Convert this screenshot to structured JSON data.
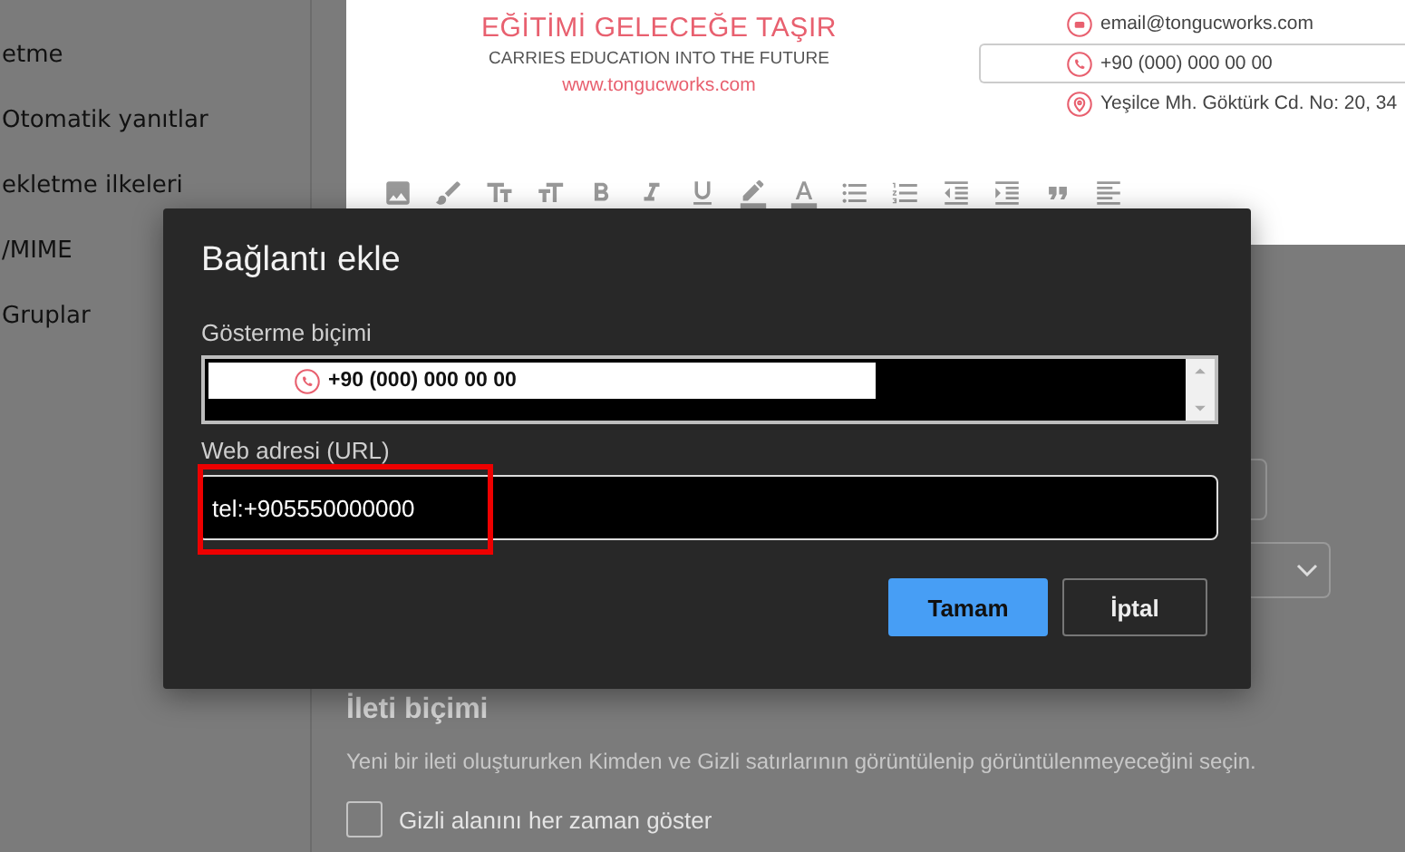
{
  "sidebar": {
    "items": [
      "etme",
      "Otomatik yanıtlar",
      "ekletme ilkeleri",
      "/MIME",
      "Gruplar"
    ]
  },
  "signature": {
    "tagline": "EĞİTİMİ GELECEĞE TAŞIR",
    "subtitle": "CARRIES EDUCATION INTO THE FUTURE",
    "website": "www.tongucworks.com",
    "contacts": [
      {
        "kind": "email",
        "text": "email@tongucworks.com",
        "selected": false
      },
      {
        "kind": "phone",
        "text": "+90 (000) 000 00 00",
        "selected": true
      },
      {
        "kind": "address",
        "text": "Yeşilce Mh. Göktürk Cd. No: 20, 34",
        "selected": false
      }
    ]
  },
  "message_format": {
    "heading": "İleti biçimi",
    "description": "Yeni bir ileti oluştururken Kimden ve Gizli satırlarının görüntülenip görüntülenmeyeceğini seçin.",
    "options": [
      {
        "label": "Gizli alanını her zaman göster",
        "checked": false
      }
    ]
  },
  "dialog": {
    "title": "Bağlantı ekle",
    "display_label": "Gösterme biçimi",
    "display_value": {
      "kind": "phone",
      "text": "+90 (000) 000 00 00"
    },
    "url_label": "Web adresi (URL)",
    "url_value": "tel:+905550000000",
    "url_highlighted": true,
    "buttons": [
      {
        "label": "Tamam",
        "kind": "primary"
      },
      {
        "label": "İptal",
        "kind": "secondary"
      }
    ]
  }
}
